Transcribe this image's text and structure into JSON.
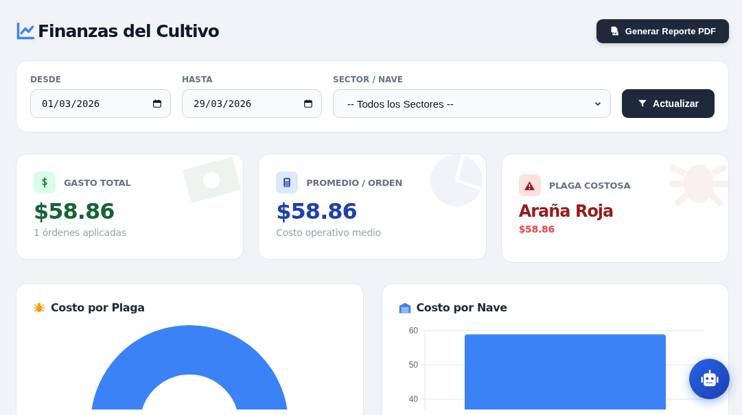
{
  "header": {
    "title": "Finanzas del Cultivo",
    "report_button": "Generar Reporte PDF"
  },
  "filters": {
    "fields": [
      {
        "kind": "date",
        "label": "DESDE",
        "value": "01/03/2026"
      },
      {
        "kind": "date",
        "label": "HASTA",
        "value": "29/03/2026"
      },
      {
        "kind": "select",
        "label": "SECTOR / NAVE",
        "value": "-- Todos los Sectores --"
      }
    ],
    "button": "Actualizar"
  },
  "stats": [
    {
      "kind": "money",
      "label": "GASTO TOTAL",
      "value": "$58.86",
      "note": "1 órdenes aplicadas"
    },
    {
      "kind": "calculator",
      "label": "PROMEDIO / ORDEN",
      "value": "$58.86",
      "note": "Costo operativo medio"
    },
    {
      "kind": "alert",
      "label": "PLAGA COSTOSA",
      "value": "Araña Roja",
      "note": "$58.86"
    }
  ],
  "charts": [
    {
      "kind": "donut",
      "title": "Costo por Plaga"
    },
    {
      "kind": "bar",
      "title": "Costo por Nave",
      "chart_data": {
        "type": "bar",
        "values": [
          58.9
        ],
        "ylim": [
          0,
          60
        ],
        "yticks": [
          40,
          50,
          60
        ]
      }
    }
  ]
}
